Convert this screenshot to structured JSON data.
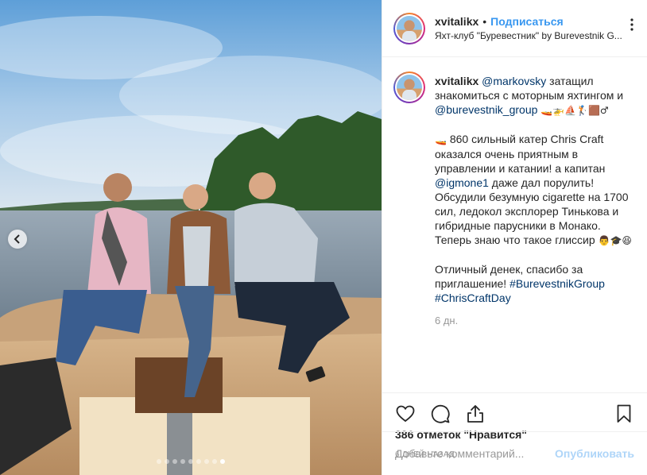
{
  "post": {
    "username": "xvitalikx",
    "bullet": "•",
    "follow_label": "Подписаться",
    "location": "Яхт-клуб \"Буревестник\" by Burevestnik G...",
    "more_label": "⋮"
  },
  "caption": {
    "username": "xvitalikx",
    "mention1": "@markovsky",
    "text1": " затащил знакомиться с моторным яхтингом и ",
    "mention2": "@burevestnik_group",
    "emojis1": " 🚤🚁⛵🏌🟫♂",
    "p2_emoji": "🚤",
    "p2_text1": " 860 сильный катер Chris Craft оказался очень приятным в управлении и катании! а капитан ",
    "mention3": "@igmone1",
    "p2_text2": " даже дал порулить! Обсудили безумную cigarette на 1700 сил, ледокол эксплорер Тинькова и гибридные парусники в Монако. Теперь знаю что такое глиссир ",
    "p2_emojis": "👨🎓😆",
    "p3_text": "Отличный денек, спасибо за приглашение! ",
    "hashtag1": "#BurevestnikGroup",
    "hashtag2": "#ChrisCraftDay"
  },
  "timestamp": "6 дн.",
  "likes": "386 отметок \"Нравится\"",
  "date": "6 ДНЕЙ НАЗАД",
  "comment_box": {
    "placeholder": "Добавьте комментарий...",
    "publish_label": "Опубликовать"
  },
  "carousel": {
    "total": 9,
    "active_index": 8
  },
  "colors": {
    "link": "#003569",
    "accent": "#3897f0",
    "muted": "#999999"
  },
  "icons": [
    "heart-icon",
    "comment-icon",
    "share-icon",
    "bookmark-icon",
    "chevron-left-icon"
  ]
}
